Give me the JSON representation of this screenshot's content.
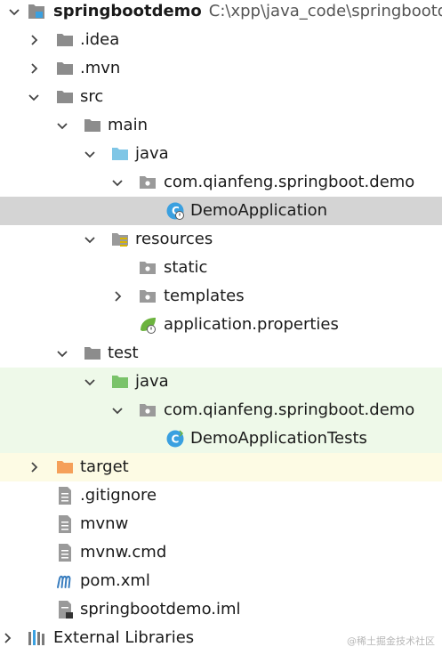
{
  "project": {
    "name": "springbootdemo",
    "path": "C:\\xpp\\java_code\\springbootdemo"
  },
  "nodes": {
    "idea": ".idea",
    "mvn": ".mvn",
    "src": "src",
    "main": "main",
    "main_java": "java",
    "main_pkg": "com.qianfeng.springboot.demo",
    "demo_app": "DemoApplication",
    "resources": "resources",
    "static": "static",
    "templates": "templates",
    "app_props": "application.properties",
    "test": "test",
    "test_java": "java",
    "test_pkg": "com.qianfeng.springboot.demo",
    "demo_tests": "DemoApplicationTests",
    "target": "target",
    "gitignore": ".gitignore",
    "mvnw": "mvnw",
    "mvnw_cmd": "mvnw.cmd",
    "pom": "pom.xml",
    "iml": "springbootdemo.iml",
    "ext_libs": "External Libraries"
  },
  "watermark": "@稀土掘金技术社区",
  "colors": {
    "selected": "#d4d4d4",
    "test_bg": "#eef9e9",
    "excluded_bg": "#fdfbe4",
    "folder": "#8c8c8c",
    "source_folder": "#7fc6e6",
    "test_folder": "#7ac36a",
    "excluded_folder": "#f5a05a"
  }
}
